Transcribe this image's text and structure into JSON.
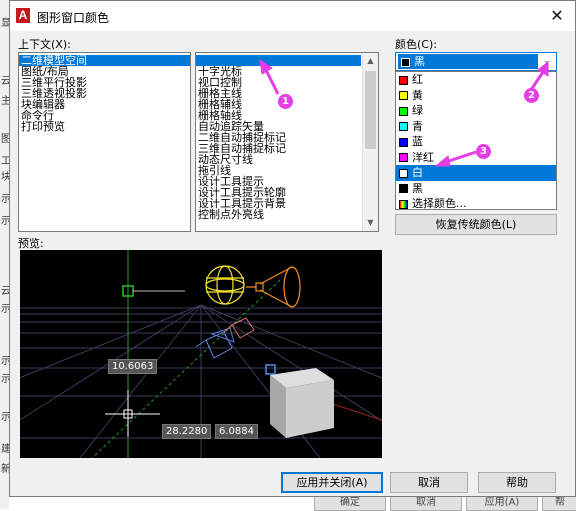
{
  "dialog": {
    "title": "图形窗口颜色",
    "close_glyph": "✕"
  },
  "context": {
    "label": "上下文(X):",
    "items": [
      "二维模型空间",
      "图纸/布局",
      "三维平行投影",
      "三维透视投影",
      "块编辑器",
      "命令行",
      "打印预览"
    ],
    "selected": 0
  },
  "interface_element": {
    "items": [
      "",
      "十字光标",
      "视口控制",
      "栅格主线",
      "栅格辅线",
      "栅格轴线",
      "自动追踪矢量",
      "二维自动捕捉标记",
      "三维自动捕捉标记",
      "动态尺寸线",
      "拖引线",
      "设计工具提示",
      "设计工具提示轮廓",
      "设计工具提示背景",
      "控制点外亮线"
    ],
    "selected": 0
  },
  "color": {
    "label": "颜色(C):",
    "current": "黑",
    "current_hex": "#000000",
    "options": [
      {
        "name": "红",
        "hex": "#ff0000"
      },
      {
        "name": "黄",
        "hex": "#ffff00"
      },
      {
        "name": "绿",
        "hex": "#00ff00"
      },
      {
        "name": "青",
        "hex": "#00ffff"
      },
      {
        "name": "蓝",
        "hex": "#0000ff"
      },
      {
        "name": "洋红",
        "hex": "#ff00ff"
      },
      {
        "name": "白",
        "hex": "#ffffff"
      },
      {
        "name": "黑",
        "hex": "#000000"
      },
      {
        "name": "选择颜色...",
        "hex": "multi"
      }
    ],
    "selected": 6
  },
  "restore_button": "恢复传统颜色(L)",
  "preview": {
    "label": "预览:",
    "dims": [
      "10.6063",
      "28.2280",
      "6.0884"
    ]
  },
  "buttons": {
    "apply_close": "应用并关闭(A)",
    "cancel": "取消",
    "help": "帮助"
  },
  "background_strip": {
    "left_chars": [
      "显",
      "云",
      "主",
      "图",
      "工",
      "块",
      "示",
      "示",
      "云",
      "示",
      "示",
      "示",
      "示",
      "建",
      "新"
    ],
    "bottom_buttons": [
      "确定",
      "取消",
      "应用(A)",
      "帮"
    ]
  },
  "annotations": [
    "1",
    "2",
    "3"
  ],
  "accent_color": "#0078d7",
  "marker_color": "#e63ee6"
}
